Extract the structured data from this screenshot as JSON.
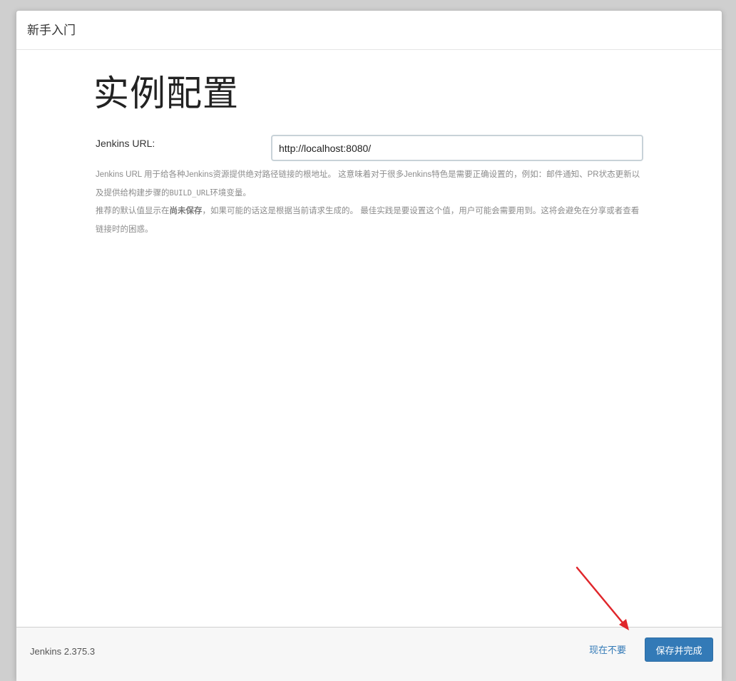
{
  "dialog": {
    "title": "新手入门"
  },
  "main": {
    "heading": "实例配置",
    "url_label": "Jenkins URL:",
    "url_value": "http://localhost:8080/",
    "help": {
      "para1_text": "Jenkins URL 用于给各种Jenkins资源提供绝对路径链接的根地址。 这意味着对于很多Jenkins特色是需要正确设置的，例如：邮件通知、PR状态更新以及提供给构建步骤的",
      "para1_code": "BUILD_URL",
      "para1_end": "环境变量。",
      "para2_start": "推荐的默认值显示在",
      "para2_bold": "尚未保存",
      "para2_end": "，如果可能的话这是根据当前请求生成的。 最佳实践是要设置这个值，用户可能会需要用到。这将会避免在分享或者查看链接时的困惑。"
    }
  },
  "footer": {
    "version": "Jenkins 2.375.3",
    "skip_label": "现在不要",
    "save_label": "保存并完成"
  },
  "colors": {
    "primary": "#337ab7",
    "annotation_arrow": "#e0262b"
  }
}
